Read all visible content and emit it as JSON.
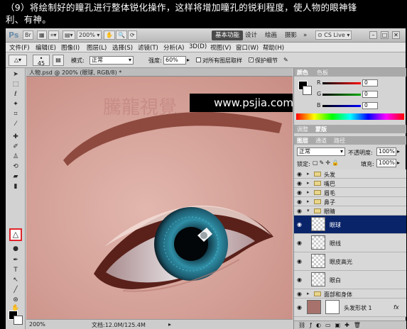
{
  "caption": {
    "line1": "（9）将绘制好的瞳孔进行整体锐化操作，这样将增加瞳孔的锐利程度，使人物的眼神锋",
    "line2": "利、有神。"
  },
  "app": {
    "logo": "Ps",
    "zoom": "200%",
    "workspaces": [
      "基本功能",
      "设计",
      "绘画",
      "摄影"
    ],
    "more": "»",
    "cslive": "CS Live"
  },
  "menu": [
    "文件(F)",
    "编辑(E)",
    "图像(I)",
    "图层(L)",
    "选择(S)",
    "滤镜(T)",
    "分析(A)",
    "3D(D)",
    "视图(V)",
    "窗口(W)",
    "帮助(H)"
  ],
  "options": {
    "brush_size": "45",
    "mode_label": "模式:",
    "mode_value": "正常",
    "strength_label": "强度:",
    "strength_value": "60%",
    "sample_all": "对所有图层取样",
    "protect_detail": "保护细节"
  },
  "document": {
    "tab_title": "人物.psd @ 200% (眼球, RGB/8) *",
    "watermark_cn": "騰龍視覺",
    "watermark_url": "www.psjia.com",
    "status_zoom": "200%",
    "status_doc": "文档:12.0M/125.4M"
  },
  "color_panel": {
    "tabs": [
      "颜色",
      "色板"
    ],
    "r_label": "R",
    "g_label": "G",
    "b_label": "B",
    "r": "0",
    "g": "0",
    "b": "0"
  },
  "adjust_tabs": [
    "调整",
    "蒙版"
  ],
  "layers_panel": {
    "tabs": [
      "图层",
      "通道",
      "路径"
    ],
    "blend_mode": "正常",
    "opacity_label": "不透明度:",
    "opacity": "100%",
    "lock_label": "锁定:",
    "fill_label": "填充:",
    "fill": "100%",
    "layers": [
      {
        "name": "头发",
        "type": "group"
      },
      {
        "name": "嘴巴",
        "type": "group"
      },
      {
        "name": "眉毛",
        "type": "group"
      },
      {
        "name": "鼻子",
        "type": "group"
      },
      {
        "name": "眼睛",
        "type": "group-open"
      },
      {
        "name": "眼球",
        "type": "layer",
        "selected": true
      },
      {
        "name": "眼线",
        "type": "layer"
      },
      {
        "name": "眼皮高光",
        "type": "layer"
      },
      {
        "name": "眼白",
        "type": "layer"
      },
      {
        "name": "面部和身体",
        "type": "group"
      },
      {
        "name": "头发形状 1",
        "type": "shape"
      }
    ],
    "fx": "fx"
  },
  "colors": {
    "selection_highlight": "#e0242a",
    "selected_layer": "#0a246a",
    "skin": "#dcaca3"
  }
}
